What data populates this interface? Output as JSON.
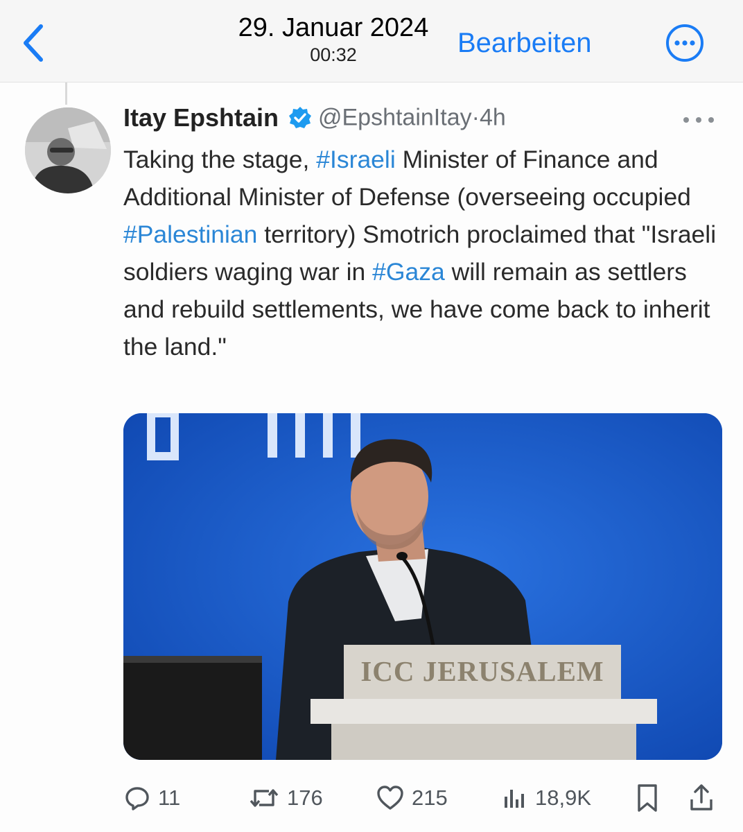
{
  "navbar": {
    "date": "29. Januar 2024",
    "time": "00:32",
    "edit_label": "Bearbeiten",
    "accent_color": "#1a7cf5",
    "icons": {
      "back": "chevron-left-icon",
      "more": "ellipsis-circle-icon"
    }
  },
  "tweet": {
    "author": {
      "display_name": "Itay Epshtain",
      "handle": "@EpshtainItay",
      "verified": true,
      "separator": "·",
      "age": "4h"
    },
    "text": {
      "p1": "Taking the stage, ",
      "tag1": "#Israeli",
      "p2": " Minister of Finance and Additional Minister of Defense (overseeing occupied ",
      "tag2": "#Palestinian",
      "p3": " territory) Smotrich proclaimed that \"Israeli soldiers waging war in ",
      "tag3": "#Gaza",
      "p4": " will remain as settlers and rebuild settlements, we have come back to inherit the land.\""
    },
    "hashtag_color": "#2a86d6",
    "media": {
      "podium_text": "ICC JERUSALEM"
    },
    "stats": {
      "replies": "11",
      "reposts": "176",
      "likes": "215",
      "views": "18,9K"
    }
  }
}
